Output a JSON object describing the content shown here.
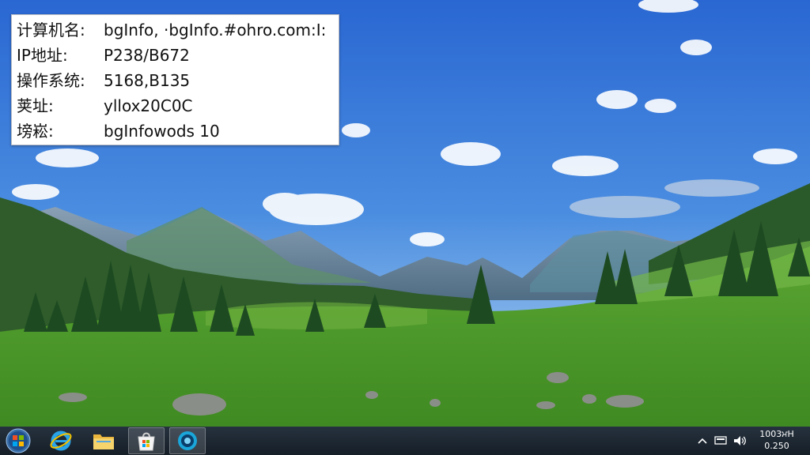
{
  "bginfo": {
    "rows": [
      {
        "key": "计算机名:",
        "value": "bgInfo, ·bgInfo.#ohro.com:I:"
      },
      {
        "key": "IP地址:",
        "value": "P238/B672"
      },
      {
        "key": "操作系统:",
        "value": "5168,B135"
      },
      {
        "key": "荚址:",
        "value": "yllox20C0C"
      },
      {
        "key": "塝崧:",
        "value": "bgInfowods 10"
      }
    ]
  },
  "taskbar": {
    "buttons": [
      {
        "icon": "windows-start-icon"
      },
      {
        "icon": "internet-explorer-icon"
      },
      {
        "icon": "file-explorer-icon"
      },
      {
        "icon": "store-icon",
        "active": true
      },
      {
        "icon": "media-player-icon",
        "active": true
      }
    ],
    "tray": {
      "icons": [
        "chevron-up-icon",
        "network-icon",
        "volume-icon"
      ],
      "clock_time": "1003ਮH",
      "clock_date": "0.250"
    }
  },
  "colors": {
    "sky_top": "#2f6fd6",
    "sky_bottom": "#a9d0f2",
    "grass": "#4f9a2c",
    "taskbar": "#1b2530"
  }
}
